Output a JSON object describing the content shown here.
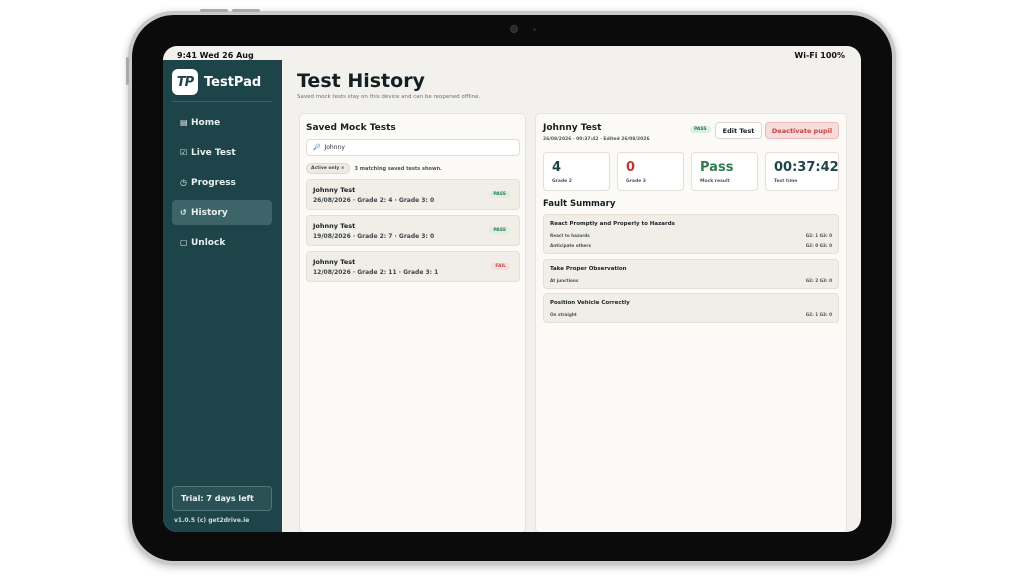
{
  "status": {
    "time": "9:41  Wed 26 Aug",
    "right": "Wi-Fi  100%"
  },
  "brand": {
    "logo": "TP",
    "name": "TestPad"
  },
  "nav": [
    {
      "icon": "▤",
      "label": "Home"
    },
    {
      "icon": "☑",
      "label": "Live Test"
    },
    {
      "icon": "◷",
      "label": "Progress"
    },
    {
      "icon": "↺",
      "label": "History",
      "active": true
    },
    {
      "icon": "▢",
      "label": "Unlock"
    }
  ],
  "trial": "Trial: 7 days left",
  "version": "v1.0.5  (c) get2drive.ie",
  "page": {
    "title": "Test History",
    "subtitle": "Saved mock tests stay on this device and can be reopened offline."
  },
  "saved": {
    "title": "Saved Mock Tests",
    "search_icon": "🔎",
    "search_value": "Johnny",
    "chip": "Active only ×",
    "count": "3 matching saved tests shown.",
    "items": [
      {
        "name": "Johnny Test",
        "meta": "26/08/2026 · Grade 2: 4 · Grade 3: 0",
        "badge": "PASS",
        "status": "pass"
      },
      {
        "name": "Johnny Test",
        "meta": "19/08/2026 · Grade 2: 7 · Grade 3: 0",
        "badge": "PASS",
        "status": "pass"
      },
      {
        "name": "Johnny Test",
        "meta": "12/08/2026 · Grade 2: 11 · Grade 3: 1",
        "badge": "FAIL",
        "status": "fail"
      }
    ]
  },
  "detail": {
    "name": "Johnny Test",
    "meta": "26/08/2026 · 00:37:42 · Edited 26/08/2026",
    "badge": "PASS",
    "edit_label": "Edit Test",
    "deactivate_label": "Deactivate pupil",
    "stats": [
      {
        "value": "4",
        "label": "Grade 2",
        "color": "#1d4549"
      },
      {
        "value": "0",
        "label": "Grade 3",
        "color": "#c0392b"
      },
      {
        "value": "Pass",
        "label": "Mock result",
        "color": "#2e7d4f"
      },
      {
        "value": "00:37:42",
        "label": "Test time",
        "color": "#1d4549"
      }
    ],
    "fault_title": "Fault Summary",
    "faults": [
      {
        "title": "React Promptly and Properly to Hazards",
        "rows": [
          {
            "label": "React to hazards",
            "vals": "G2: 1   G3: 0"
          },
          {
            "label": "Anticipate others",
            "vals": "G2: 0   G3: 0"
          }
        ]
      },
      {
        "title": "Take Proper Observation",
        "rows": [
          {
            "label": "At junctions",
            "vals": "G2: 2   G3: 0"
          }
        ]
      },
      {
        "title": "Position Vehicle Correctly",
        "rows": [
          {
            "label": "On straight",
            "vals": "G2: 1   G3: 0"
          }
        ]
      }
    ]
  }
}
